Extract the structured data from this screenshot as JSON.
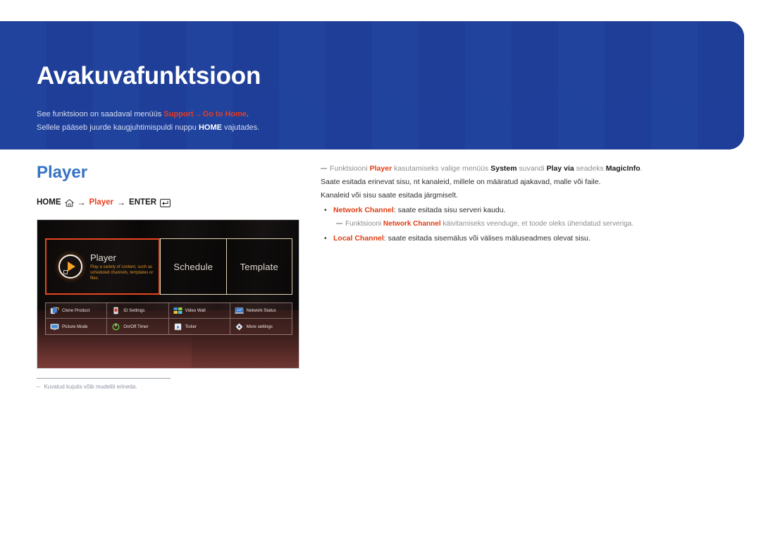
{
  "header": {
    "title": "Avakuvafunktsioon",
    "subtitle_line1_pre": "See funktsioon on saadaval menüüs ",
    "subtitle_line1_menu1": "Support",
    "subtitle_line1_arrow": "→",
    "subtitle_line1_menu2": "Go to Home",
    "subtitle_line1_post": ".",
    "subtitle_line2_pre": "Sellele pääseb juurde kaugjuhtimispuldi nuppu ",
    "subtitle_line2_key": "HOME",
    "subtitle_line2_post": " vajutades.",
    "accent_color": "#ea3c1e",
    "banner_color": "#1e3f9c"
  },
  "left": {
    "section_title": "Player",
    "section_title_color": "#3573c4",
    "breadcrumb": {
      "home_label": "HOME",
      "home_icon": "home-icon",
      "arrow1": "→",
      "player_label": "Player",
      "arrow2": "→",
      "enter_label": "ENTER",
      "enter_icon": "enter-key-icon"
    },
    "note_dash": "–",
    "note_text": "Kuvatud kujutis võib mudeliti erineda."
  },
  "tv_screen": {
    "tiles": [
      {
        "name": "Player",
        "description": "Play a variety of content, such as scheduled channels, templates or files.",
        "selected": true,
        "icon": "play-circle-icon"
      },
      {
        "name": "Schedule",
        "description": "",
        "selected": false,
        "icon": ""
      },
      {
        "name": "Template",
        "description": "",
        "selected": false,
        "icon": ""
      }
    ],
    "selection_color": "#e8461c",
    "grid_items": [
      {
        "label": "Clone Product",
        "icon": "clone-product-icon"
      },
      {
        "label": "ID Settings",
        "icon": "id-settings-icon"
      },
      {
        "label": "Video Wall",
        "icon": "video-wall-icon"
      },
      {
        "label": "Network Status",
        "icon": "network-status-icon"
      },
      {
        "label": "Picture Mode",
        "icon": "picture-mode-icon"
      },
      {
        "label": "On/Off Timer",
        "icon": "on-off-timer-icon"
      },
      {
        "label": "Ticker",
        "icon": "ticker-icon"
      },
      {
        "label": "More settings",
        "icon": "more-settings-icon"
      }
    ]
  },
  "right": {
    "note1_pre": "Funktsiooni ",
    "note1_b1": "Player",
    "note1_mid1": " kasutamiseks valige menüüs ",
    "note1_b2": "System",
    "note1_mid2": " suvandi ",
    "note1_b3": "Play via",
    "note1_mid3": " seadeks ",
    "note1_b4": "MagicInfo",
    "note1_post": ".",
    "line2": "Saate esitada erinevat sisu, nt kanaleid, millele on määratud ajakavad, malle või faile.",
    "line3": "Kanaleid või sisu saate esitada järgmiselt.",
    "bullet1_marker": "•",
    "bullet1_b": "Network Channel",
    "bullet1_text": ": saate esitada sisu serveri kaudu.",
    "subnote_pre": "Funktsiooni ",
    "subnote_b": "Network Channel",
    "subnote_post": " käivitamiseks veenduge, et toode oleks ühendatud serveriga.",
    "bullet2_marker": "•",
    "bullet2_b": "Local Channel",
    "bullet2_text": ": saate esitada sisemälus või välises mäluseadmes olevat sisu."
  }
}
